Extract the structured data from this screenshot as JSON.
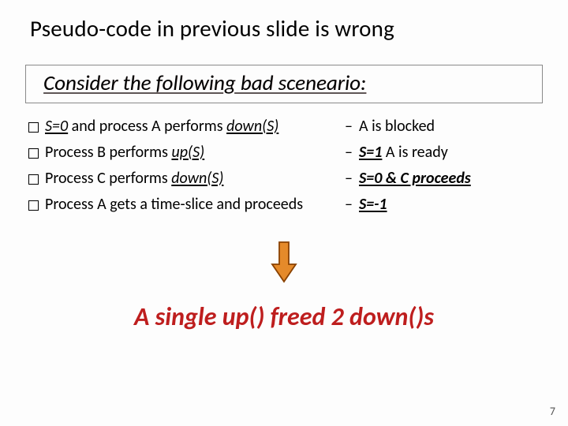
{
  "title": "Pseudo-code in previous slide is wrong",
  "subtitle": "Consider the following bad sceneario:",
  "rows": [
    {
      "left_prefix": "",
      "left_em1": "S=0",
      "left_mid": " and process A performs ",
      "left_em2": "down(S)",
      "right_plain": "A is blocked",
      "right_em": "",
      "right_em_after": ""
    },
    {
      "left_prefix": "Process B performs ",
      "left_em1": "",
      "left_mid": "",
      "left_em2": "up(S)",
      "right_plain": "",
      "right_em": "S=1",
      "right_em_after": " A is ready"
    },
    {
      "left_prefix": "Process C performs ",
      "left_em1": "",
      "left_mid": "",
      "left_em2": "down(S)",
      "right_plain": "",
      "right_em": "S=0  & C proceeds",
      "right_em_after": ""
    },
    {
      "left_prefix": "Process A gets a time-slice and proceeds",
      "left_em1": "",
      "left_mid": "",
      "left_em2": "",
      "right_plain": "",
      "right_em": "S=-1",
      "right_em_after": ""
    }
  ],
  "conclusion": "A single up() freed 2 down()s",
  "page_number": "7",
  "arrow_color_fill": "#e58a2a",
  "arrow_color_stroke": "#8a4200"
}
